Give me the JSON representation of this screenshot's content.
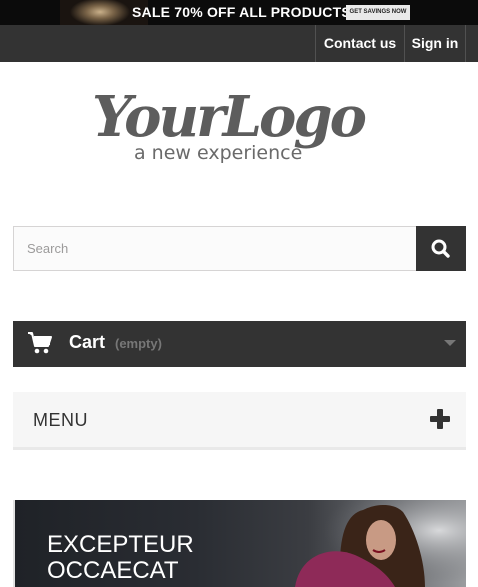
{
  "promo": {
    "text": "SALE 70% OFF ALL PRODUCTS",
    "cta": "GET SAVINGS NOW"
  },
  "topnav": {
    "contact": "Contact us",
    "signin": "Sign in"
  },
  "logo": {
    "script": "YourLogo",
    "tagline": "a new experience"
  },
  "search": {
    "placeholder": "Search",
    "button_icon": "search-icon"
  },
  "cart": {
    "label": "Cart",
    "status": "(empty)",
    "icon": "shopping-cart-icon"
  },
  "menu": {
    "label": "MENU",
    "icon": "plus-icon"
  },
  "slider": {
    "title_line1": "EXCEPTEUR",
    "title_line2": "OCCAECAT"
  },
  "colors": {
    "dark": "#333333",
    "promo_bg": "#0b0b0b",
    "muted": "#777777",
    "menu_bg": "#f6f6f6"
  }
}
